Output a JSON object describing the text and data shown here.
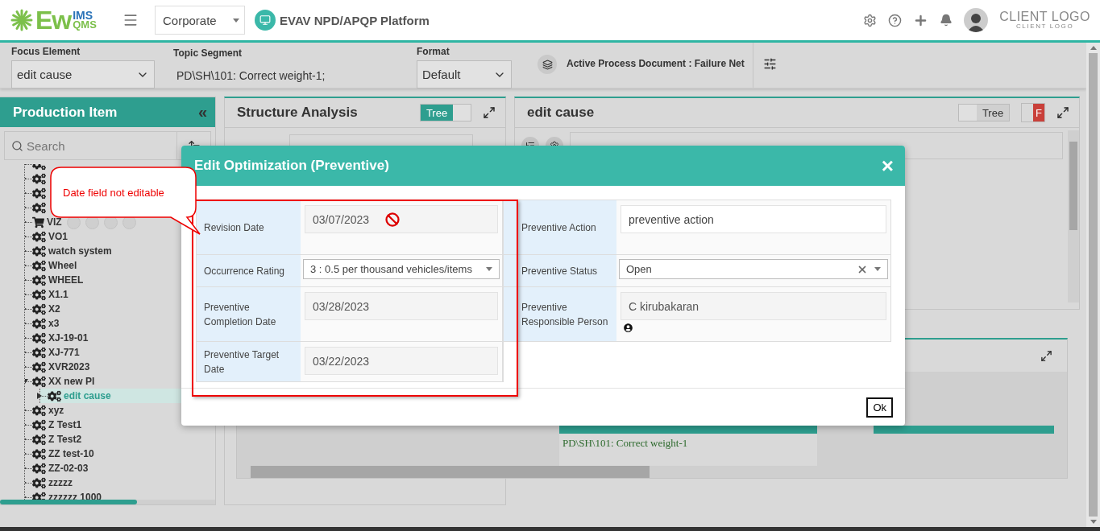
{
  "header": {
    "logo": {
      "main": "Ew",
      "sup": "IMS",
      "sub": "QMS"
    },
    "company_select": "Corporate",
    "platform_title": "EVAV NPD/APQP Platform",
    "client_logo": {
      "main": "CLIENT LOGO",
      "sub": "CLIENT LOGO"
    }
  },
  "filter_bar": {
    "focus_element": {
      "label": "Focus Element",
      "value": "edit cause"
    },
    "topic_segment": {
      "label": "Topic Segment",
      "value": "PD\\SH\\101: Correct weight-1;"
    },
    "format": {
      "label": "Format",
      "value": "Default"
    },
    "active_document": "Active Process Document : Failure Net"
  },
  "sidebar": {
    "title": "Production Item",
    "collapse": "«",
    "search": {
      "placeholder": "Search"
    },
    "tree": [
      {
        "kind": "gear",
        "expanded": false
      },
      {
        "kind": "gear",
        "expanded": false
      },
      {
        "kind": "gear",
        "expanded": false
      },
      {
        "kind": "gear",
        "expanded": false
      },
      {
        "kind": "cart",
        "label": "VIZ",
        "expanded": false,
        "selected": false,
        "hovered": true
      },
      {
        "kind": "gear",
        "label": "VO1",
        "expanded": false,
        "selected": false,
        "hovered": false
      },
      {
        "kind": "gear",
        "label": "watch system",
        "expanded": false,
        "selected": false,
        "hovered": false
      },
      {
        "kind": "gear",
        "label": "Wheel",
        "expanded": false,
        "selected": false,
        "hovered": false
      },
      {
        "kind": "gear",
        "label": "WHEEL",
        "expanded": false,
        "selected": false,
        "hovered": false
      },
      {
        "kind": "gear",
        "label": "X1.1",
        "expanded": false,
        "selected": false,
        "hovered": false
      },
      {
        "kind": "gear",
        "label": "X2",
        "expanded": false,
        "selected": false,
        "hovered": false
      },
      {
        "kind": "gear",
        "label": "x3",
        "expanded": false,
        "selected": false,
        "hovered": false
      },
      {
        "kind": "gear",
        "label": "XJ-19-01",
        "expanded": false,
        "selected": false,
        "hovered": false
      },
      {
        "kind": "gear",
        "label": "XJ-771",
        "expanded": false,
        "selected": false,
        "hovered": false
      },
      {
        "kind": "gear",
        "label": "XVR2023",
        "expanded": false,
        "selected": false,
        "hovered": false
      },
      {
        "kind": "gear",
        "label": "XX new PI",
        "expanded": true,
        "selected": false,
        "hovered": false,
        "children": [
          {
            "kind": "gear",
            "label": "edit cause",
            "expanded": false,
            "selected": true,
            "hovered": false
          }
        ]
      },
      {
        "kind": "gear",
        "label": "xyz",
        "expanded": false,
        "selected": false,
        "hovered": false
      },
      {
        "kind": "gear",
        "label": "Z Test1",
        "expanded": false,
        "selected": false,
        "hovered": false
      },
      {
        "kind": "gear",
        "label": "Z Test2",
        "expanded": false,
        "selected": false,
        "hovered": false
      },
      {
        "kind": "gear",
        "label": "ZZ test-10",
        "expanded": false,
        "selected": false,
        "hovered": false
      },
      {
        "kind": "gear",
        "label": "ZZ-02-03",
        "expanded": false,
        "selected": false,
        "hovered": false
      },
      {
        "kind": "gear",
        "label": "zzzzz",
        "expanded": false,
        "selected": false,
        "hovered": false
      },
      {
        "kind": "gear",
        "label": "zzzzzz 1000",
        "expanded": false,
        "selected": false,
        "hovered": false
      }
    ]
  },
  "structure_panel": {
    "title": "Structure Analysis",
    "toggle": {
      "label": "Tree",
      "on": true
    }
  },
  "cause_panel": {
    "title": "edit cause",
    "tree_toggle": {
      "label": "Tree",
      "on": false
    },
    "f_toggle": {
      "label": "F",
      "on": true
    }
  },
  "lower_panel": {
    "cell": "PD\\SH\\101: Correct weight-1"
  },
  "dialog": {
    "title": "Edit Optimization (Preventive)",
    "close": "×",
    "rows": [
      {
        "left": {
          "label": "Revision Date",
          "kind": "date",
          "value": "03/07/2023",
          "disabled": true,
          "locked": true
        },
        "right": {
          "label": "Preventive Action",
          "kind": "text",
          "value": "preventive action",
          "disabled": false
        }
      },
      {
        "left": {
          "label": "Occurrence Rating",
          "kind": "select",
          "value": "3 : 0.5 per thousand vehicles/items"
        },
        "right": {
          "label": "Preventive Status",
          "kind": "select",
          "value": "Open",
          "clearable": true
        }
      },
      {
        "left": {
          "label": "Preventive Completion Date",
          "kind": "date",
          "value": "03/28/2023",
          "disabled": true
        },
        "right": {
          "label": "Preventive Responsible Person",
          "kind": "person",
          "value": "C kirubakaran",
          "disabled": true
        }
      },
      {
        "left": {
          "label": "Preventive Target Date",
          "kind": "date",
          "value": "03/22/2023",
          "disabled": true
        }
      }
    ],
    "ok": "Ok"
  },
  "callout": {
    "text": "Date field not editable"
  }
}
